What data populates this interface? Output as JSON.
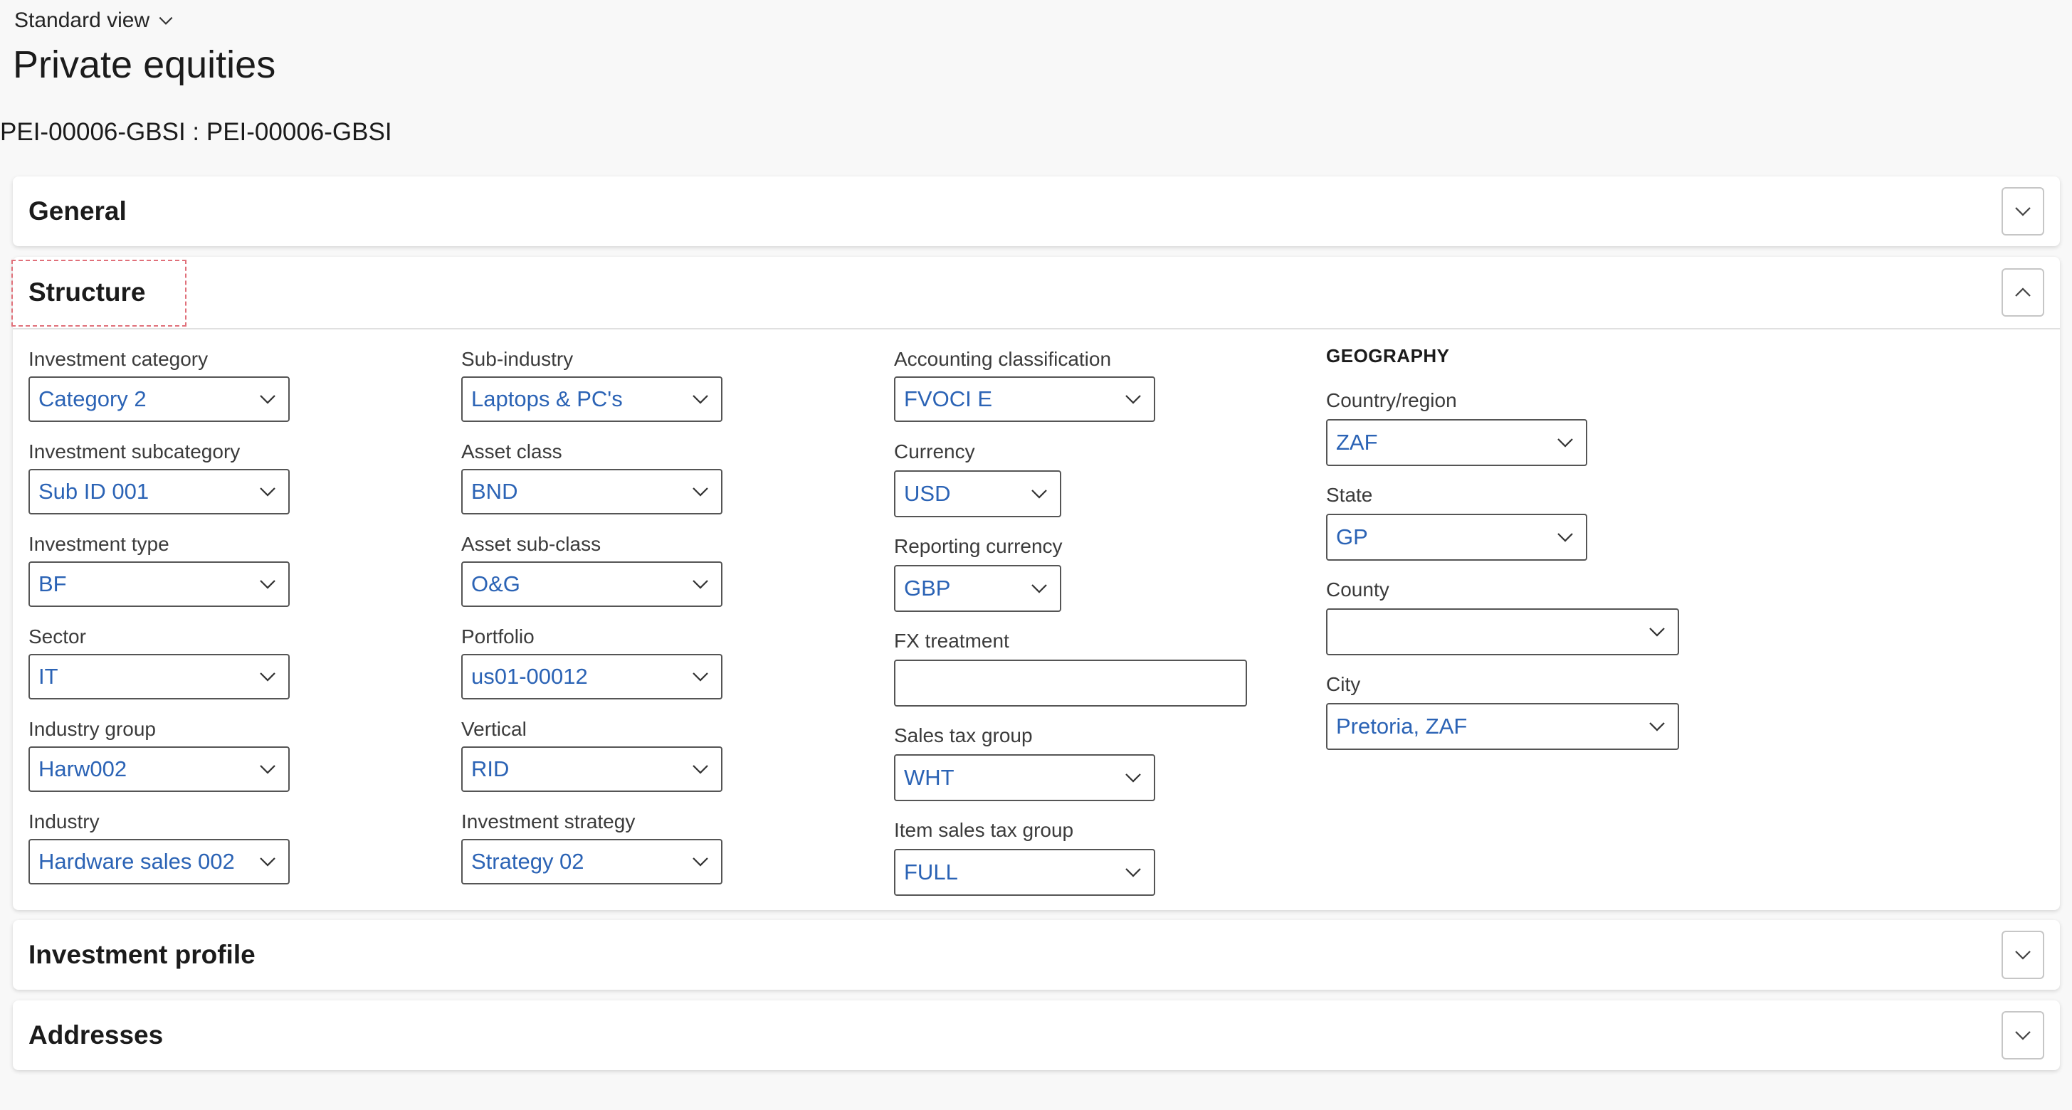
{
  "header": {
    "view_label": "Standard view",
    "page_title": "Private equities",
    "record_title": "PEI-00006-GBSI : PEI-00006-GBSI"
  },
  "sections": {
    "general": {
      "title": "General",
      "expanded": false
    },
    "structure": {
      "title": "Structure",
      "expanded": true
    },
    "investment_profile": {
      "title": "Investment profile",
      "expanded": false
    },
    "addresses": {
      "title": "Addresses",
      "expanded": false
    }
  },
  "structure": {
    "col1": [
      {
        "label": "Investment category",
        "value": "Category 2"
      },
      {
        "label": "Investment subcategory",
        "value": "Sub ID 001"
      },
      {
        "label": "Investment type",
        "value": "BF"
      },
      {
        "label": "Sector",
        "value": "IT"
      },
      {
        "label": "Industry group",
        "value": "Harw002"
      },
      {
        "label": "Industry",
        "value": "Hardware sales 002"
      }
    ],
    "col2": [
      {
        "label": "Sub-industry",
        "value": "Laptops & PC's"
      },
      {
        "label": "Asset class",
        "value": "BND"
      },
      {
        "label": "Asset sub-class",
        "value": "O&G"
      },
      {
        "label": "Portfolio",
        "value": "us01-00012"
      },
      {
        "label": "Vertical",
        "value": "RID"
      },
      {
        "label": "Investment strategy",
        "value": "Strategy 02"
      }
    ],
    "col3": [
      {
        "label": "Accounting classification",
        "value": "FVOCI E"
      },
      {
        "label": "Currency",
        "value": "USD"
      },
      {
        "label": "Reporting currency",
        "value": "GBP"
      },
      {
        "label": "FX treatment",
        "value": ""
      },
      {
        "label": "Sales tax group",
        "value": "WHT"
      },
      {
        "label": "Item sales tax group",
        "value": "FULL"
      }
    ],
    "geography": {
      "heading": "GEOGRAPHY",
      "fields": [
        {
          "label": "Country/region",
          "value": "ZAF"
        },
        {
          "label": "State",
          "value": "GP"
        },
        {
          "label": "County",
          "value": ""
        },
        {
          "label": "City",
          "value": "Pretoria, ZAF"
        }
      ]
    }
  },
  "icons": {
    "view_chevron": "chevron-down-icon",
    "expand": "chevron-down-icon",
    "collapse": "chevron-up-icon",
    "dropdown": "chevron-down-icon"
  },
  "colors": {
    "value_text": "#2b63b5",
    "focus_outline": "#e0707a"
  }
}
